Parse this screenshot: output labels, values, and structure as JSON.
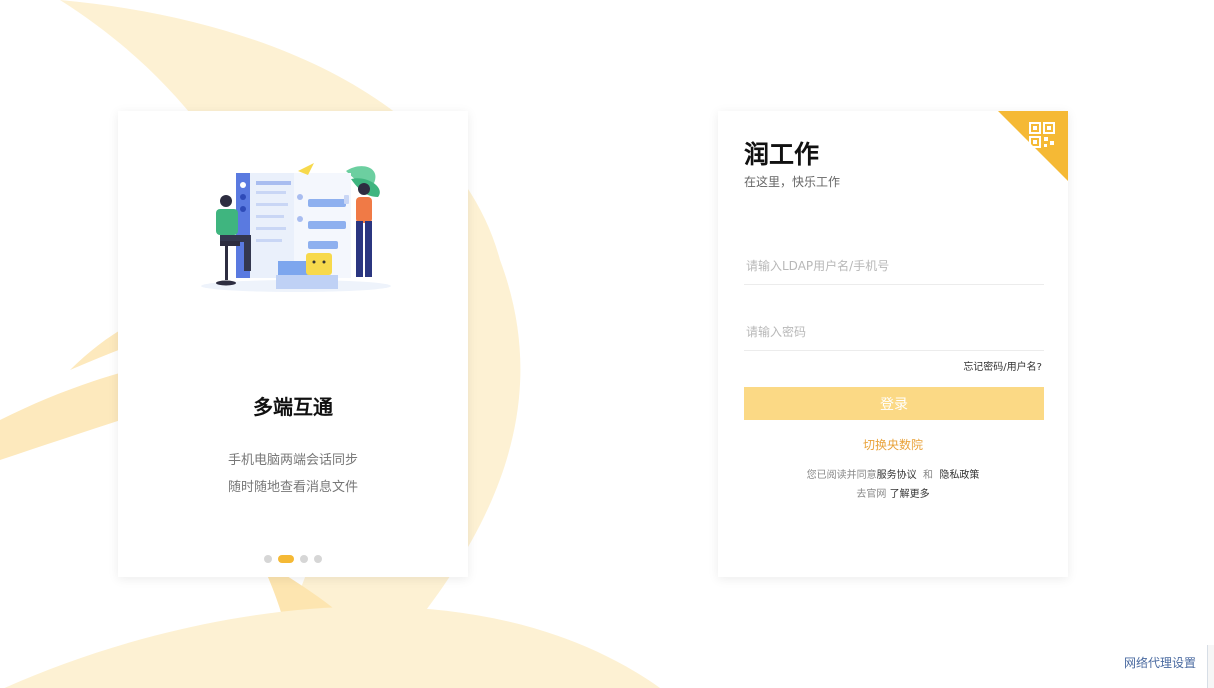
{
  "colors": {
    "accent": "#f5b935",
    "button": "#fbd985",
    "link": "#e9a33b",
    "proxy_link": "#4a6aa0",
    "background_shape": "#fdf1d3"
  },
  "promo": {
    "title": "多端互通",
    "lines": [
      "手机电脑两端会话同步",
      "随时随地查看消息文件"
    ],
    "pagination": {
      "count": 4,
      "active_index": 1
    }
  },
  "login": {
    "app_name": "润工作",
    "slogan": "在这里，快乐工作",
    "corner_icon": "qr-code-icon",
    "username_placeholder": "请输入LDAP用户名/手机号",
    "password_placeholder": "请输入密码",
    "forgot_label": "忘记密码/用户名?",
    "submit_label": "登录",
    "switch_label": "切换央数院",
    "agreement": {
      "prefix": "您已阅读并同意",
      "service_link": "服务协议",
      "and": "和",
      "privacy_link": "隐私政策"
    },
    "official": {
      "prefix": "去官网",
      "link": "了解更多"
    }
  },
  "footer": {
    "proxy_label": "网络代理设置"
  }
}
